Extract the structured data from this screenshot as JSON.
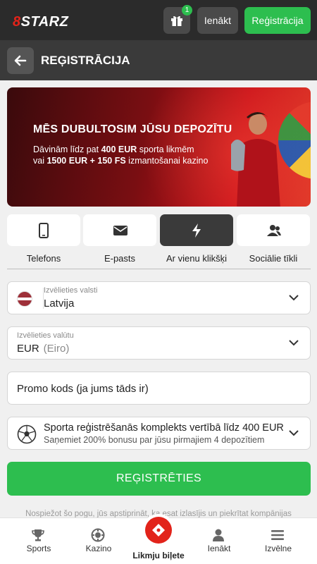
{
  "header": {
    "logo_text": "8STARZ",
    "gift_badge": "1",
    "login_label": "Ienākt",
    "register_label": "Reģistrācija"
  },
  "titlebar": {
    "title": "REĢISTRĀCIJA"
  },
  "banner": {
    "headline": "MĒS DUBULTOSIM JŪSU DEPOZĪTU",
    "line1_pre": "Dāvinām līdz pat ",
    "line1_bold": "400 EUR",
    "line1_post": " sporta likmēm",
    "line2_pre": "vai ",
    "line2_bold": "1500 EUR + 150 FS",
    "line2_post": " izmantošanai kazino"
  },
  "methods": [
    {
      "label": "Telefons",
      "icon": "phone-icon"
    },
    {
      "label": "E-pasts",
      "icon": "mail-icon"
    },
    {
      "label": "Ar vienu klikšķi",
      "icon": "lightning-icon"
    },
    {
      "label": "Sociālie tīkli",
      "icon": "people-icon"
    }
  ],
  "form": {
    "country": {
      "label": "Izvēlieties valsti",
      "value": "Latvija"
    },
    "currency": {
      "label": "Izvēlieties valūtu",
      "code": "EUR",
      "name": "(Eiro)"
    },
    "promo": {
      "placeholder": "Promo kods (ja jums tāds ir)"
    },
    "bonus": {
      "title": "Sporta reģistrēšanās komplekts vertībā līdz 400 EUR",
      "subtitle": "Saņemiet 200% bonusu par jūsu pirmajiem 4 depozītiem"
    },
    "submit_label": "REĢISTRĒTIES"
  },
  "terms_text": "Nospiežot šo pogu, jūs apstiprināt, ka esat izlasījis un piekrītat kompānijas",
  "bottom_nav": [
    {
      "label": "Sports",
      "icon": "trophy-icon"
    },
    {
      "label": "Kazino",
      "icon": "chip-icon"
    },
    {
      "label": "Likmju biļete",
      "icon": "ticket-icon"
    },
    {
      "label": "Ienākt",
      "icon": "user-icon"
    },
    {
      "label": "Izvēlne",
      "icon": "menu-icon"
    }
  ],
  "colors": {
    "accent_green": "#2dbe4f",
    "brand_red": "#e2231a",
    "dark": "#2b2b2b"
  }
}
